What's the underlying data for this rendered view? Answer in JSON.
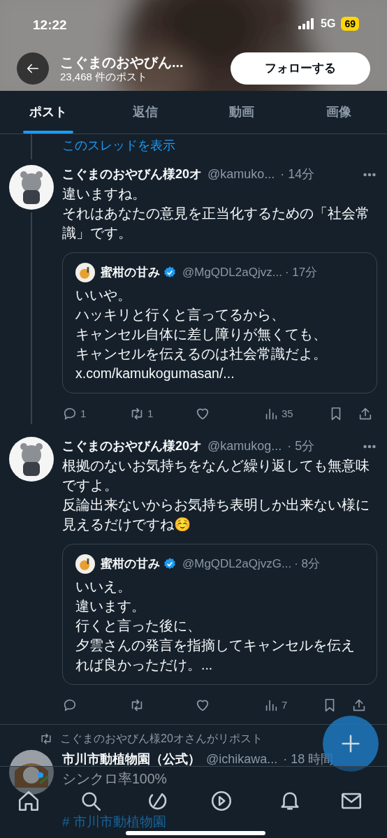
{
  "status_bar": {
    "time": "12:22",
    "network": "5G",
    "battery": "69"
  },
  "header": {
    "title": "こぐまのおやびん...",
    "subtitle": "23,468 件のポスト",
    "follow_button": "フォローする"
  },
  "tabs": [
    {
      "label": "ポスト",
      "selected": true
    },
    {
      "label": "返信",
      "selected": false
    },
    {
      "label": "動画",
      "selected": false
    },
    {
      "label": "画像",
      "selected": false
    }
  ],
  "thread_link": "このスレッドを表示",
  "posts": [
    {
      "name": "こぐまのおやびん様20オ",
      "handle": "@kamuko...",
      "time": "· 14分",
      "body": [
        "違いますね。",
        "それはあなたの意見を正当化するための「社会常識」です。"
      ],
      "thread_line": true,
      "quote": {
        "name": "蜜柑の甘み",
        "verified": true,
        "handle": "@MgQDL2aQjvz...",
        "time": "· 17分",
        "body": [
          "いいや。",
          "ハッキリと行くと言ってるから、",
          "キャンセル自体に差し障りが無くても、",
          "キャンセルを伝えるのは社会常識だよ。",
          "x.com/kamukogumasan/..."
        ]
      },
      "actions": [
        {
          "kind": "reply",
          "count": "1"
        },
        {
          "kind": "repost",
          "count": "1"
        },
        {
          "kind": "like"
        },
        {
          "kind": "views",
          "count": "35"
        },
        {
          "kind": "bookmark"
        },
        {
          "kind": "share"
        }
      ]
    },
    {
      "name": "こぐまのおやびん様20オ",
      "handle": "@kamukog...",
      "time": "· 5分",
      "body": [
        "根拠のないお気持ちをなんど繰り返しても無意味ですよ。",
        "反論出来ないからお気持ち表明しか出来ない様に見えるだけですね☺️"
      ],
      "thread_line": false,
      "quote": {
        "name": "蜜柑の甘み",
        "verified": true,
        "handle": "@MgQDL2aQjvzG...",
        "time": "· 8分",
        "body": [
          "いいえ。",
          "違います。",
          "行くと言った後に、",
          "夕雲さんの発言を指摘してキャンセルを伝えれば良かっただけ。..."
        ]
      },
      "actions": [
        {
          "kind": "reply"
        },
        {
          "kind": "repost"
        },
        {
          "kind": "like"
        },
        {
          "kind": "views",
          "count": "7"
        },
        {
          "kind": "bookmark"
        },
        {
          "kind": "share"
        }
      ]
    }
  ],
  "repost_post": {
    "reposted_by": "こぐまのおやびん様20オさんがリポスト",
    "name": "市川市動植物園（公式）",
    "handle": "@ichikawa...",
    "time": "· 18 時間",
    "body": "シンクロ率100%",
    "hashtag": "# 市川市動植物園"
  },
  "bottom_nav": [
    {
      "kind": "home",
      "dot": true
    },
    {
      "kind": "search",
      "dot": false
    },
    {
      "kind": "grok",
      "dot": false
    },
    {
      "kind": "play",
      "dot": false
    },
    {
      "kind": "notifications",
      "dot": false
    },
    {
      "kind": "messages",
      "dot": false
    }
  ]
}
